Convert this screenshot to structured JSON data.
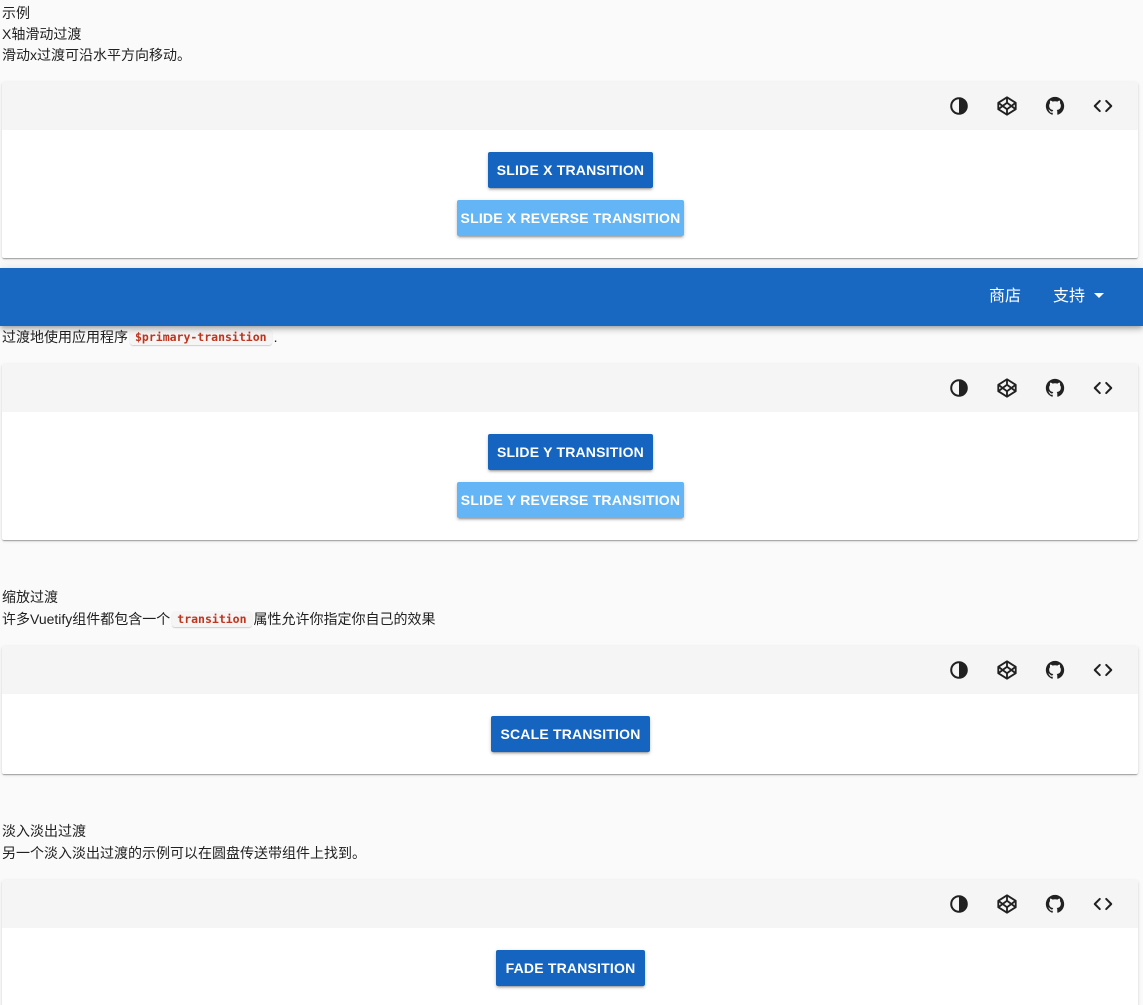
{
  "intro": {
    "heading": "示例",
    "subheading": "X轴滑动过渡",
    "description": "滑动x过渡可沿水平方向移动。"
  },
  "toolbar_icons": [
    "invert-colors-icon",
    "codepen-icon",
    "github-icon",
    "code-icon"
  ],
  "demo_slide_x": {
    "buttons": {
      "slide_x": "SLIDE X TRANSITION",
      "slide_x_reverse": "SLIDE X REVERSE TRANSITION"
    }
  },
  "appbar": {
    "store": "商店",
    "support": "支持"
  },
  "partial_text": {
    "before": "过渡地使用应用程序",
    "code": "$primary-transition",
    "after": "."
  },
  "demo_slide_y": {
    "buttons": {
      "slide_y": "SLIDE Y TRANSITION",
      "slide_y_reverse": "SLIDE Y REVERSE TRANSITION"
    }
  },
  "scale_section": {
    "heading": "缩放过渡",
    "desc_before": "许多Vuetify组件都包含一个",
    "desc_code": "transition",
    "desc_after": "属性允许你指定你自己的效果"
  },
  "demo_scale": {
    "buttons": {
      "scale": "SCALE TRANSITION"
    }
  },
  "fade_section": {
    "heading": "淡入淡出过渡",
    "description": "另一个淡入淡出过渡的示例可以在圆盘传送带组件上找到。"
  },
  "demo_fade": {
    "buttons": {
      "fade": "FADE TRANSITION"
    }
  },
  "colors": {
    "primary_button": "#1565c0",
    "light_button": "#64b5f6",
    "appbar": "#1867c0",
    "toolbar": "#f5f5f5",
    "code_text": "#c0341d"
  }
}
